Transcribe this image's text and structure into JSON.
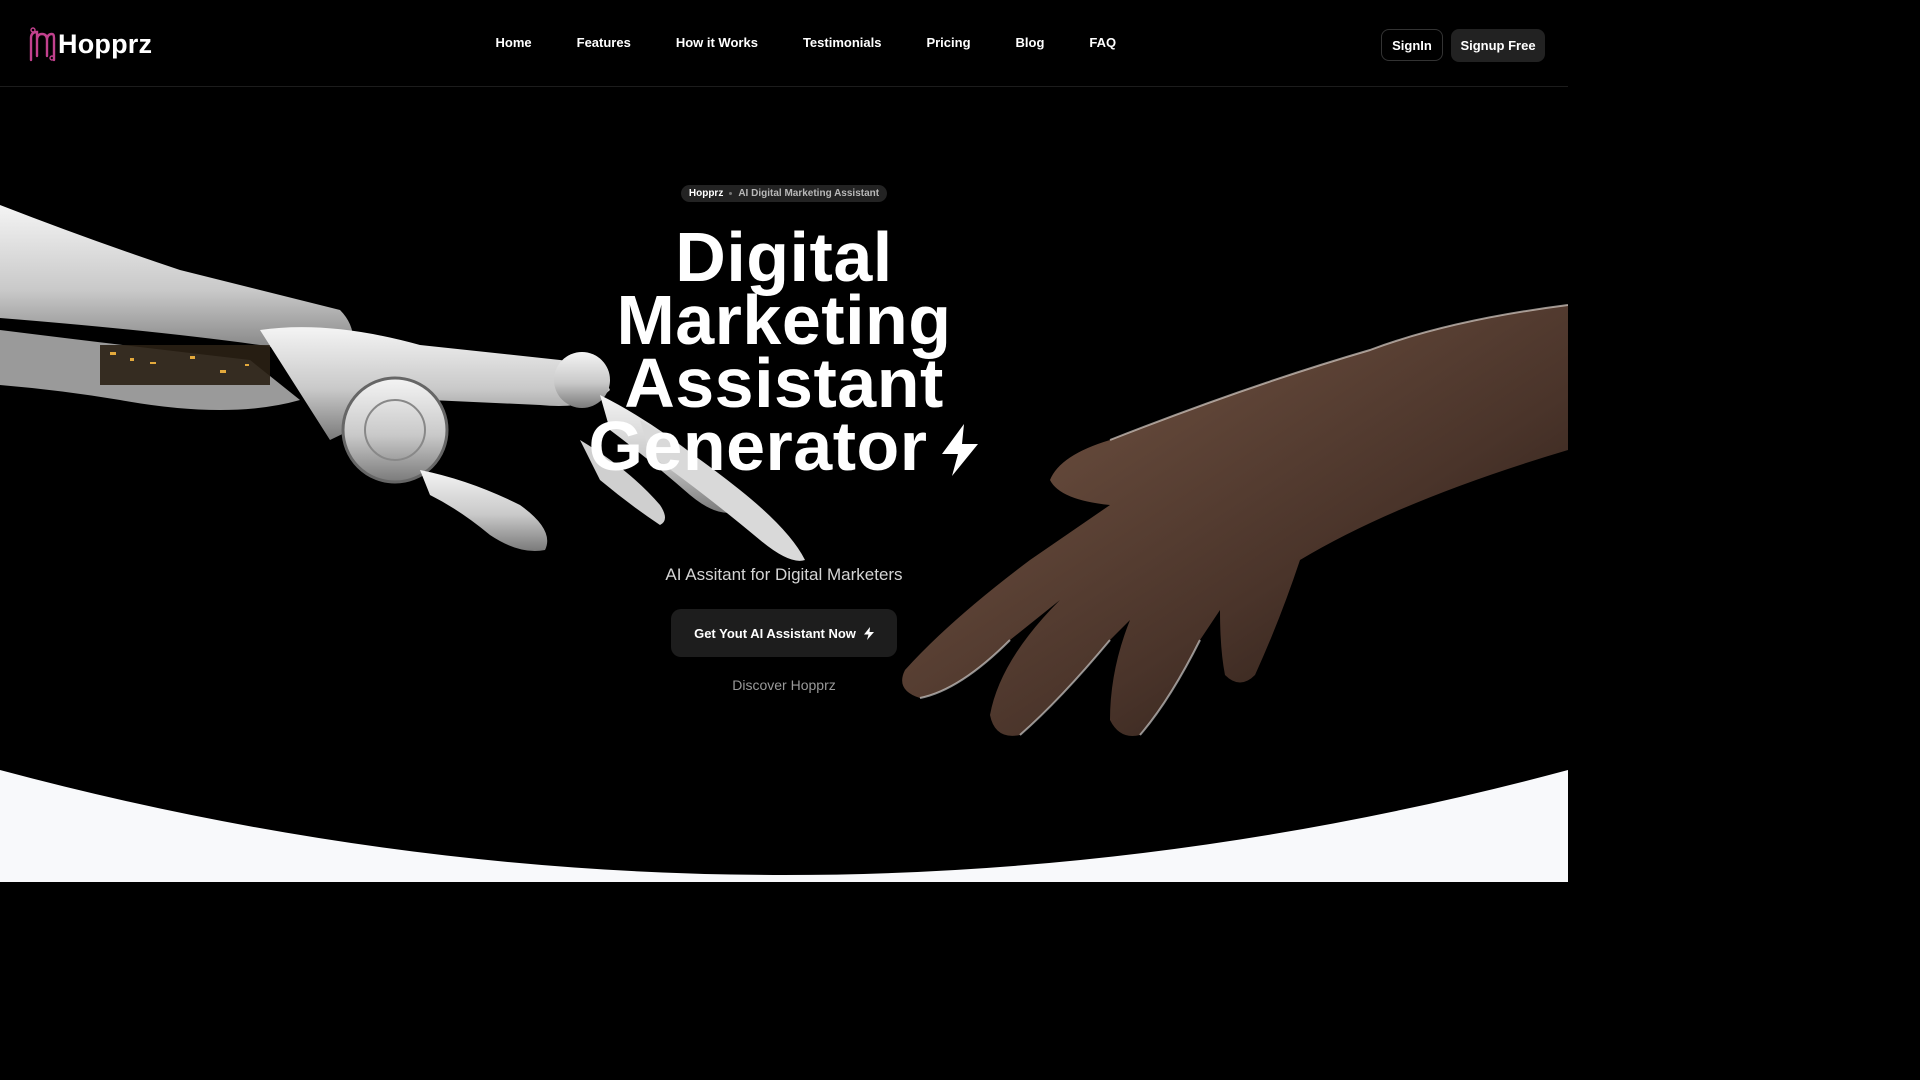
{
  "brand": {
    "name": "Hopprz",
    "accent": "#c2418e"
  },
  "nav": {
    "links": [
      "Home",
      "Features",
      "How it Works",
      "Testimonials",
      "Pricing",
      "Blog",
      "FAQ"
    ],
    "signin_label": "SignIn",
    "signup_label": "Signup Free"
  },
  "hero": {
    "pill_brand": "Hopprz",
    "pill_tag": "AI Digital Marketing Assistant",
    "headline_lines": [
      "Digital",
      "Marketing",
      "Assistant",
      "Generator"
    ],
    "subtitle": "AI Assitant for Digital Marketers",
    "cta_label": "Get Yout AI Assistant Now",
    "discover_label": "Discover Hopprz"
  },
  "colors": {
    "background": "#000000",
    "button": "#1d1d1d",
    "curve": "#f8f9fb"
  },
  "icons": {
    "cta": "lightning-bolt-icon",
    "headline": "lightning-bolt-icon"
  }
}
